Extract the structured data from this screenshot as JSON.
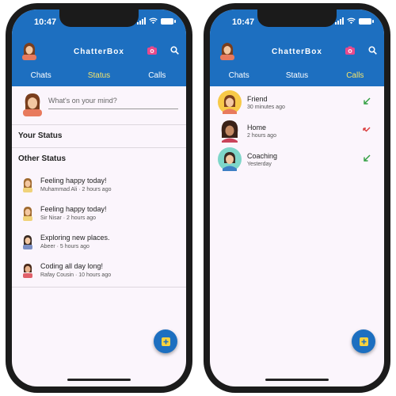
{
  "status_bar": {
    "time": "10:47"
  },
  "app": {
    "title": "ChatterBox"
  },
  "tabs": [
    "Chats",
    "Status",
    "Calls"
  ],
  "screen_status": {
    "active_tab": "Status",
    "mind_placeholder": "What's on your mind?",
    "your_status_heading": "Your Status",
    "other_status_heading": "Other Status",
    "statuses": [
      {
        "text": "Feeling happy today!",
        "meta": "Muhammad Ali · 2 hours ago"
      },
      {
        "text": "Feeling happy today!",
        "meta": "Sir Nisar · 2 hours ago"
      },
      {
        "text": "Exploring new places.",
        "meta": "Abeer · 5 hours ago"
      },
      {
        "text": "Coding all day long!",
        "meta": "Rafay Cousin · 10 hours ago"
      }
    ]
  },
  "screen_calls": {
    "active_tab": "Calls",
    "calls": [
      {
        "name": "Friend",
        "time": "30 minutes ago",
        "direction": "incoming",
        "status_color": "#2e9e3e",
        "avatar_bg": "#f7c948"
      },
      {
        "name": "Home",
        "time": "2 hours ago",
        "direction": "missed",
        "status_color": "#d93a3a",
        "avatar_bg": "none"
      },
      {
        "name": "Coaching",
        "time": "Yesterday",
        "direction": "incoming",
        "status_color": "#2e9e3e",
        "avatar_bg": "#7ed6c9"
      }
    ]
  },
  "colors": {
    "primary": "#1d6fc0",
    "active_tab": "#f5e46a",
    "background": "#fbf5fc",
    "fab_icon": "#f7d23e"
  },
  "icons": {
    "camera": "camera-icon",
    "search": "search-icon",
    "fab": "add-status-icon"
  }
}
